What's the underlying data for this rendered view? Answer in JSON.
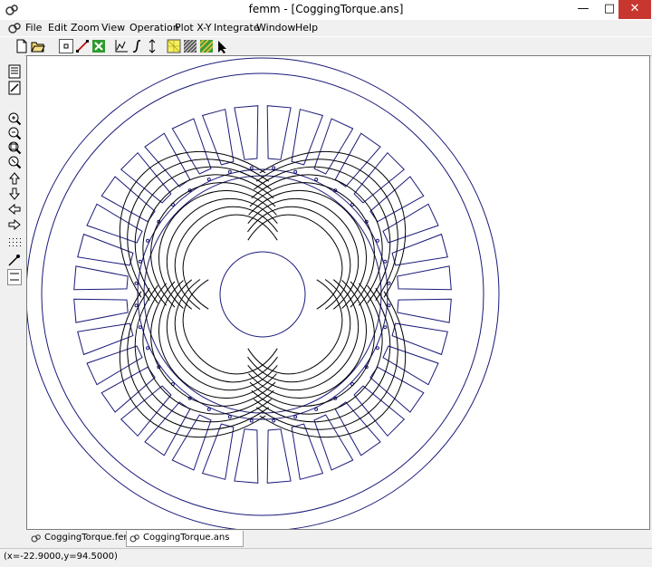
{
  "window": {
    "title": "femm - [CoggingTorque.ans]"
  },
  "menu": [
    "File",
    "Edit",
    "Zoom",
    "View",
    "Operation",
    "Plot X-Y",
    "Integrate",
    "Window",
    "Help"
  ],
  "toolbar_icons": [
    "new-file-icon",
    "open-file-icon",
    "point-mode-icon",
    "contour-mode-icon",
    "area-mode-icon",
    "plot-xy-icon",
    "integral-icon",
    "smooth-icon",
    "show-mesh-icon",
    "density-plot-icon",
    "vector-plot-icon",
    "select-arrow-icon"
  ],
  "side_toolbar_icons": [
    "refresh-icon",
    "snap-grid-icon",
    "zoom-natural-icon",
    "zoom-in-icon",
    "zoom-out-icon",
    "zoom-window-icon",
    "pan-up-icon",
    "pan-down-icon",
    "pan-left-icon",
    "pan-right-icon",
    "show-grid-icon",
    "snap-icon",
    "grid-size-icon"
  ],
  "tabs": [
    {
      "label": "CoggingTorque.fem",
      "active": false
    },
    {
      "label": "CoggingTorque.ans",
      "active": true
    }
  ],
  "status": {
    "coords": "(x=-22.9000,y=94.5000)"
  },
  "colors": {
    "geometry": "#1a1a7a",
    "flux_lines": "#000000",
    "canvas": "#ffffff",
    "close_button": "#c7372f"
  }
}
